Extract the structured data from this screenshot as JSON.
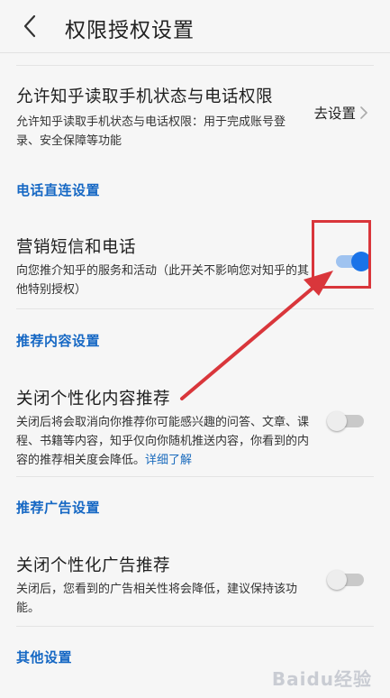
{
  "header": {
    "title": "权限授权设置"
  },
  "phone_permission": {
    "title": "允许知乎读取手机状态与电话权限",
    "desc": "允许知乎读取手机状态与电话权限：用于完成账号登录、安全保障等功能",
    "action_label": "去设置"
  },
  "sections": {
    "phone_direct": "电话直连设置",
    "recommend_content": "推荐内容设置",
    "recommend_ads": "推荐广告设置",
    "other": "其他设置"
  },
  "marketing": {
    "title": "营销短信和电话",
    "desc": "向您推介知乎的服务和活动（此开关不影响您对知乎的其他特别授权）",
    "enabled": true
  },
  "personalized_content": {
    "title": "关闭个性化内容推荐",
    "desc": "关闭后将会取消向你推荐你可能感兴趣的问答、文章、课程、书籍等内容，知乎仅向你随机推送内容，你看到的内容的推荐相关度会降低。",
    "link_label": "详细了解",
    "enabled": false
  },
  "personalized_ads": {
    "title": "关闭个性化广告推荐",
    "desc": "关闭后，您看到的广告相关性将会降低，建议保持该功能。",
    "enabled": false
  },
  "watermark": "Baidu经验",
  "colors": {
    "accent": "#1a73e8",
    "section": "#1668c4",
    "annotation": "#d9363b"
  }
}
